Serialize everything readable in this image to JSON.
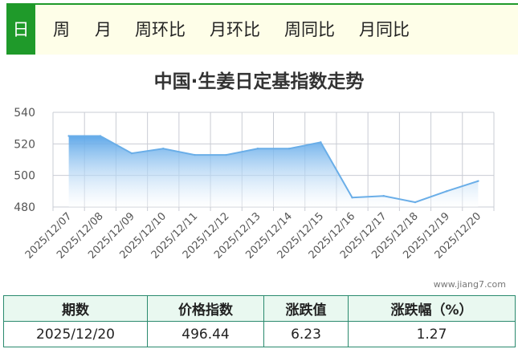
{
  "tabs": [
    {
      "label": "日",
      "active": true
    },
    {
      "label": "周",
      "active": false
    },
    {
      "label": "月",
      "active": false
    },
    {
      "label": "周环比",
      "active": false
    },
    {
      "label": "月环比",
      "active": false
    },
    {
      "label": "周同比",
      "active": false
    },
    {
      "label": "月同比",
      "active": false
    }
  ],
  "watermark": "www.jiang7.com",
  "colors": {
    "accent": "#1f9a2a",
    "line": "#6aaee8",
    "area_top": "#6aaee8",
    "table_border": "#2a8a6e",
    "table_header_bg": "#e9f8f0"
  },
  "chart_data": {
    "type": "area",
    "title": "中国·生姜日定基指数走势",
    "categories": [
      "2025/12/07",
      "2025/12/08",
      "2025/12/09",
      "2025/12/10",
      "2025/12/11",
      "2025/12/12",
      "2025/12/13",
      "2025/12/14",
      "2025/12/15",
      "2025/12/16",
      "2025/12/17",
      "2025/12/18",
      "2025/12/19",
      "2025/12/20"
    ],
    "series": [
      {
        "values": [
          525,
          525,
          514,
          517,
          513,
          513,
          517,
          517,
          521,
          486,
          487,
          483,
          490,
          496.44
        ]
      }
    ],
    "yticks": [
      480,
      500,
      520,
      540
    ],
    "ylim": [
      480,
      540
    ],
    "grid": true
  },
  "table": {
    "headers": [
      "期数",
      "价格指数",
      "涨跌值",
      "涨跌幅（%）"
    ],
    "row": [
      "2025/12/20",
      "496.44",
      "6.23",
      "1.27"
    ]
  }
}
